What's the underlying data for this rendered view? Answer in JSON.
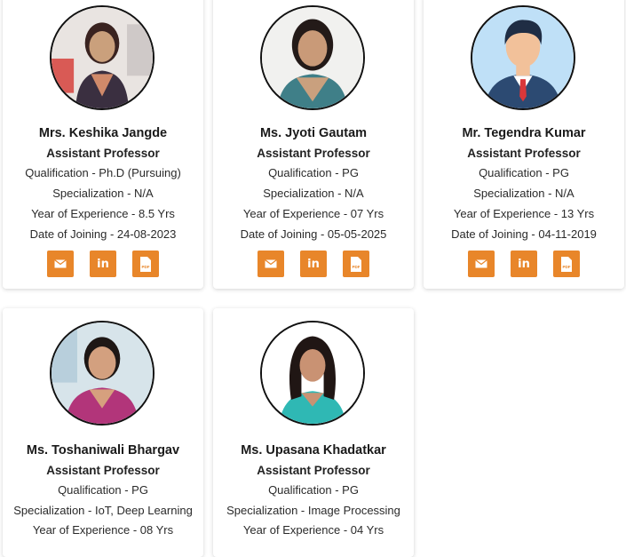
{
  "faculty": [
    {
      "name": "Mrs. Keshika Jangde",
      "designation": "Assistant Professor",
      "qualification": "Qualification - Ph.D (Pursuing)",
      "specialization": "Specialization - N/A",
      "experience": "Year of Experience - 8.5 Yrs",
      "joining": "Date of Joining - 24-08-2023"
    },
    {
      "name": "Ms. Jyoti Gautam",
      "designation": "Assistant Professor",
      "qualification": "Qualification - PG",
      "specialization": "Specialization - N/A",
      "experience": "Year of Experience - 07 Yrs",
      "joining": "Date of Joining - 05-05-2025"
    },
    {
      "name": "Mr. Tegendra Kumar",
      "designation": "Assistant Professor",
      "qualification": "Qualification - PG",
      "specialization": "Specialization - N/A",
      "experience": "Year of Experience - 13 Yrs",
      "joining": "Date of Joining - 04-11-2019"
    },
    {
      "name": "Ms. Toshaniwali Bhargav",
      "designation": "Assistant Professor",
      "qualification": "Qualification - PG",
      "specialization": "Specialization - IoT, Deep Learning",
      "experience": "Year of Experience - 08 Yrs"
    },
    {
      "name": "Ms. Upasana Khadatkar",
      "designation": "Assistant Professor",
      "qualification": "Qualification - PG",
      "specialization": "Specialization - Image Processing",
      "experience": "Year of Experience - 04 Yrs"
    }
  ],
  "icons": {
    "email": "email-icon",
    "linkedin": "linkedin-icon",
    "linkedin_text": "in",
    "pdf": "pdf-icon",
    "pdf_text": "PDF"
  },
  "colors": {
    "accent": "#e8862a",
    "card_bg": "#ffffff"
  }
}
